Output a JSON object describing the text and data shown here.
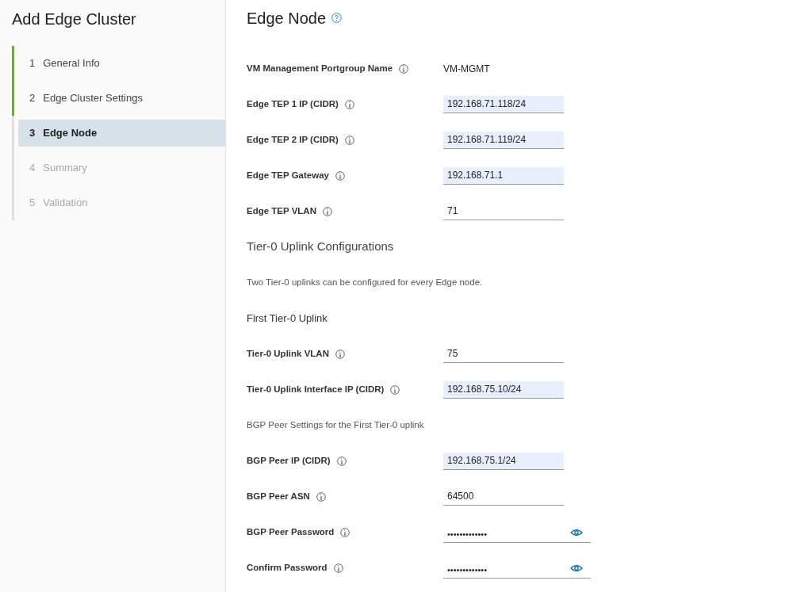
{
  "sidebar": {
    "title": "Add Edge Cluster",
    "steps": [
      {
        "number": "1",
        "label": "General Info",
        "completed": true,
        "disabled": false,
        "selected": false
      },
      {
        "number": "2",
        "label": "Edge Cluster Settings",
        "completed": true,
        "disabled": false,
        "selected": false
      },
      {
        "number": "3",
        "label": "Edge Node",
        "completed": false,
        "disabled": false,
        "selected": true
      },
      {
        "number": "4",
        "label": "Summary",
        "completed": false,
        "disabled": true,
        "selected": false
      },
      {
        "number": "5",
        "label": "Validation",
        "completed": false,
        "disabled": true,
        "selected": false
      }
    ]
  },
  "main": {
    "title": "Edge Node",
    "items": [
      {
        "kind": "static",
        "label": "VM Management Portgroup Name",
        "value": "VM-MGMT"
      },
      {
        "kind": "field",
        "label": "Edge TEP 1 IP (CIDR)",
        "value": "192.168.71.118/24",
        "autofilled": true
      },
      {
        "kind": "field",
        "label": "Edge TEP 2 IP (CIDR)",
        "value": "192.168.71.119/24",
        "autofilled": true
      },
      {
        "kind": "field",
        "label": "Edge TEP Gateway",
        "value": "192.168.71.1",
        "autofilled": true
      },
      {
        "kind": "field",
        "label": "Edge TEP VLAN",
        "value": "71",
        "autofilled": false
      },
      {
        "kind": "heading",
        "text": "Tier-0 Uplink Configurations"
      },
      {
        "kind": "note",
        "text": "Two Tier-0 uplinks can be configured for every Edge node."
      },
      {
        "kind": "subheading",
        "text": "First Tier-0 Uplink"
      },
      {
        "kind": "field",
        "label": "Tier-0 Uplink VLAN",
        "value": "75",
        "autofilled": false
      },
      {
        "kind": "field",
        "label": "Tier-0 Uplink Interface IP (CIDR)",
        "value": "192.168.75.10/24",
        "autofilled": true
      },
      {
        "kind": "note",
        "text": "BGP Peer Settings for the First Tier-0 uplink"
      },
      {
        "kind": "field",
        "label": "BGP Peer IP (CIDR)",
        "value": "192.168.75.1/24",
        "autofilled": true
      },
      {
        "kind": "field",
        "label": "BGP Peer ASN",
        "value": "64500",
        "autofilled": false
      },
      {
        "kind": "password",
        "label": "BGP Peer Password",
        "value": "•••••••••••••"
      },
      {
        "kind": "password",
        "label": "Confirm Password",
        "value": "•••••••••••••"
      }
    ]
  }
}
